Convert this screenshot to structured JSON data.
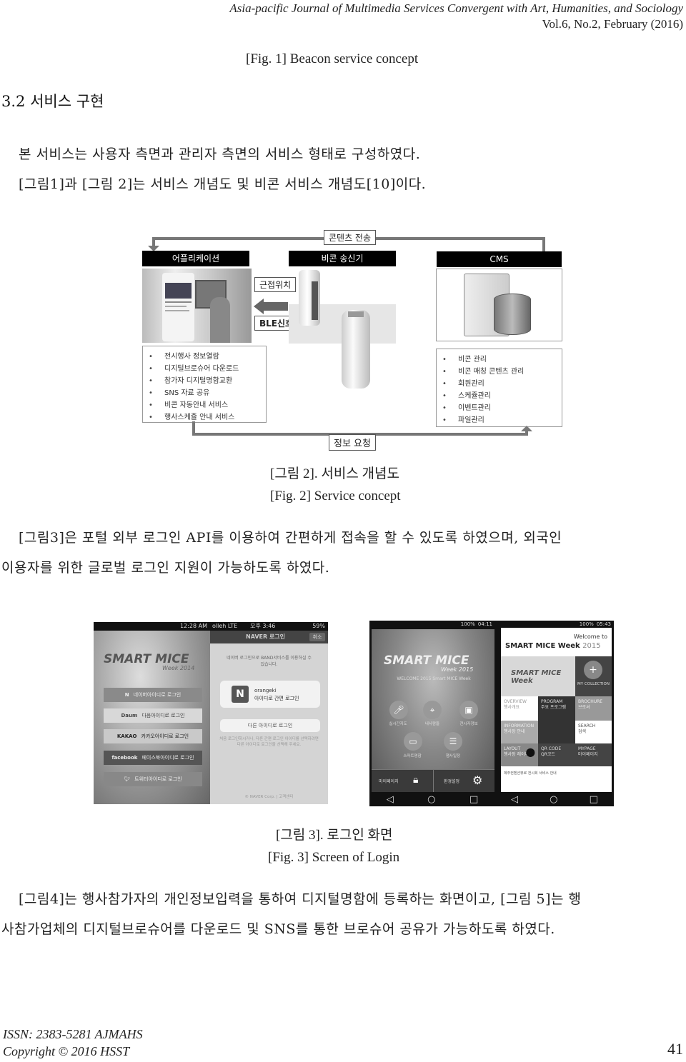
{
  "header": {
    "journal": "Asia-pacific Journal of Multimedia Services Convergent with Art, Humanities, and Sociology",
    "volume": "Vol.6, No.2, February (2016)"
  },
  "fig1_caption_en": "[Fig. 1] Beacon service concept",
  "section": {
    "number_title": "3.2 서비스 구현"
  },
  "paragraphs": {
    "p1_line1": "본 서비스는 사용자 측면과 관리자 측면의 서비스 형태로 구성하였다.",
    "p1_line2": "[그림1]과 [그림 2]는 서비스 개념도 및 비콘 서비스 개념도[10]이다.",
    "p2_line1": "[그림3]은 포털 외부 로그인 API를 이용하여 간편하게 접속을 할 수 있도록 하였으며, 외국인",
    "p2_line2": "이용자를 위한 글로벌 로그인 지원이 가능하도록 하였다.",
    "p3_line1": "[그림4]는 행사참가자의 개인정보입력을 통하여 디지털명함에 등록하는 화면이고, [그림 5]는 행",
    "p3_line2": "사참가업체의 디지털브로슈어를 다운로드 및 SNS를 통한 브로슈어 공유가 가능하도록 하였다."
  },
  "figure2": {
    "top_arrow_label": "콘텐츠 전송",
    "bottom_arrow_label": "정보 요청",
    "columns": [
      {
        "title": "어플리케이션"
      },
      {
        "title": "비콘 송신기"
      },
      {
        "title": "CMS"
      }
    ],
    "signal_labels": [
      "근접위치",
      "BLE신호"
    ],
    "app_features": [
      "전시행사 정보열람",
      "디지털브로슈어 다운로드",
      "참가자 디지털명함교환",
      "SNS 자료 공유",
      "비콘 자동안내 서비스",
      "행사스케쥴 안내 서비스"
    ],
    "cms_features": [
      "비콘 관리",
      "비콘 매칭 콘텐츠 관리",
      "회원관리",
      "스케쥴관리",
      "이벤트관리",
      "파일관리"
    ],
    "caption_ko": "[그림 2]. 서비스 개념도",
    "caption_en": "[Fig. 2] Service concept"
  },
  "figure3": {
    "screen1": {
      "status": "12:28 AM",
      "logo": "SMART MICE",
      "logo_sub": "Week 2014",
      "buttons": [
        {
          "brand": "N",
          "label": "네이버아이디로 로그인"
        },
        {
          "brand": "Daum",
          "label": "다음아이디로 로그인"
        },
        {
          "brand": "KAKAO",
          "label": "카카오아이디로 로그인"
        },
        {
          "brand": "facebook",
          "label": "페이스북아이디로 로그인"
        },
        {
          "brand": "twitter",
          "label": "트위터아이디로 로그인"
        }
      ]
    },
    "screen2": {
      "status_left": "olleh LTE",
      "status_time": "오후 3:46",
      "status_right": "59%",
      "title": "NAVER 로그인",
      "cancel": "취소",
      "notice": "네이버 로그인으로 BAND서비스를 이용하실 수 있습니다.",
      "account_id": "orangeki",
      "account_action": "아이디로 간편 로그인",
      "other_login": "다른 아이디로 로그인",
      "help": "처음 로그인하시거나, 다른 간편 로그인 아이디를 선택하려면 다른 아이디로 로그인을 선택해 주세요.",
      "footer": "© NAVER Corp. | 고객센터"
    },
    "screen3": {
      "status_time": "04:11",
      "status_batt": "100%",
      "logo": "SMART MICE",
      "logo_sub": "Week 2015",
      "welcome": "WELCOME 2015 Smart MICE Week",
      "menu": [
        "실시간지도",
        "내사람들",
        "전시자정보",
        "스마트명함",
        "행사일정"
      ],
      "bottom": [
        {
          "label": "마이페이지",
          "icon": "lock-icon"
        },
        {
          "label": "환경설정",
          "icon": "gear-icon"
        }
      ]
    },
    "screen4": {
      "status_time": "05:43",
      "status_batt": "100%",
      "welcome_small": "Welcome to",
      "welcome_big": "SMART MICE Week",
      "welcome_year": "2015",
      "my_collection": "MY COLLECTION",
      "tiles": [
        {
          "en": "OVERVIEW",
          "ko": "행사개요"
        },
        {
          "en": "PROGRAM",
          "ko": "주요 프로그램"
        },
        {
          "en": "BROCHURE",
          "ko": "브로셔"
        },
        {
          "en": "INFORMATION",
          "ko": "행사장 안내"
        },
        {
          "en": "SEARCH",
          "ko": "검색"
        },
        {
          "en": "LAYOUT",
          "ko": "행사장 레이아웃"
        },
        {
          "en": "QR CODE",
          "ko": "QR코드"
        },
        {
          "en": "MYPAGE",
          "ko": "마이페이지"
        }
      ],
      "footer_note": "제주컨벤션뷰로 전시회 서비스 안내"
    },
    "caption_ko": "[그림 3]. 로그인 화면",
    "caption_en": "[Fig. 3] Screen of Login"
  },
  "footer": {
    "issn": "ISSN: 2383-5281 AJMAHS",
    "copyright": "Copyright © 2016 HSST",
    "page_number": "41"
  }
}
